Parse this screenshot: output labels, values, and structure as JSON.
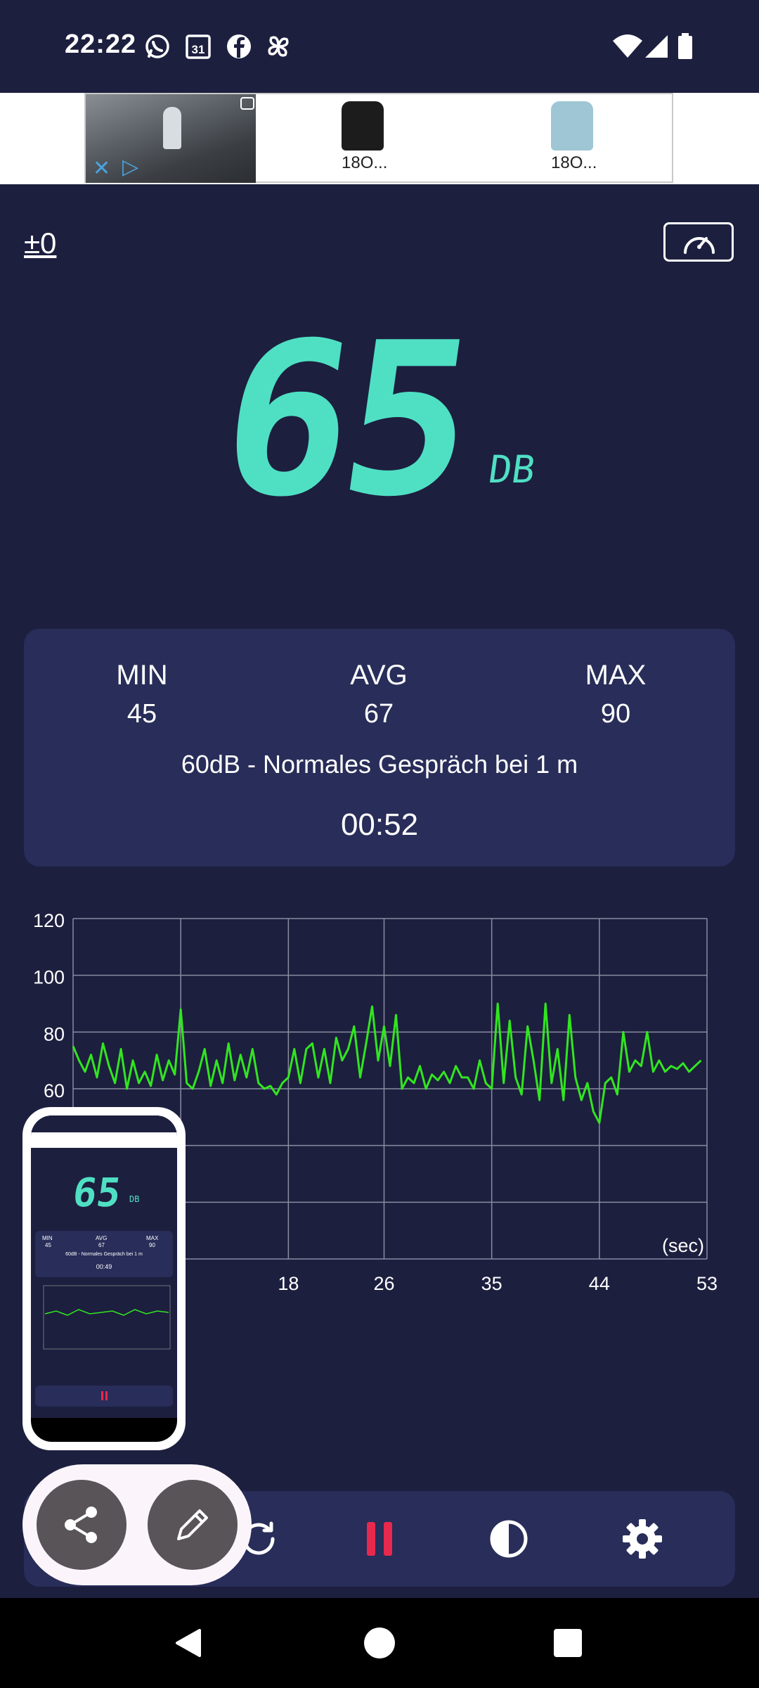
{
  "status_bar": {
    "time": "22:22",
    "notification_icons": [
      "whatsapp-icon",
      "calendar-icon",
      "facebook-icon",
      "pinwheel-icon"
    ],
    "calendar_day": "31",
    "right_icons": [
      "wifi-icon",
      "signal-icon",
      "battery-icon"
    ]
  },
  "ad": {
    "products": [
      {
        "price": "18O...",
        "color": "#1c1c1c"
      },
      {
        "price": "18O...",
        "color": "#9fc6d4"
      }
    ],
    "close_symbol": "✕",
    "play_symbol": "▷"
  },
  "controls": {
    "calibration": "±0",
    "mode_icon": "speedometer-icon"
  },
  "display": {
    "value": "65",
    "unit": "DB",
    "color": "#4fe0c4"
  },
  "stats": {
    "min_label": "MIN",
    "min_value": "45",
    "avg_label": "AVG",
    "avg_value": "67",
    "max_label": "MAX",
    "max_value": "90",
    "description": "60dB - Normales Gespräch bei 1 m",
    "timer": "00:52"
  },
  "chart_data": {
    "type": "line",
    "ylim": [
      0,
      120
    ],
    "xlim": [
      0,
      53
    ],
    "y_ticks": [
      "120",
      "100",
      "80",
      "60"
    ],
    "x_ticks": [
      "18",
      "26",
      "35",
      "44",
      "53"
    ],
    "x_unit": "(sec)",
    "grid": true,
    "line_color": "#31e61f",
    "series": [
      {
        "x": [
          0,
          0.5,
          1,
          1.5,
          2,
          2.5,
          3,
          3.5,
          4,
          4.5,
          5,
          5.5,
          6,
          6.5,
          7,
          7.5,
          8,
          8.5,
          9,
          9.5,
          10,
          10.5,
          11,
          11.5,
          12,
          12.5,
          13,
          13.5,
          14,
          14.5,
          15,
          15.5,
          16,
          16.5,
          17,
          17.5,
          18,
          18.5,
          19,
          19.5,
          20,
          20.5,
          21,
          21.5,
          22,
          22.5,
          23,
          23.5,
          24,
          24.5,
          25,
          25.5,
          26,
          26.5,
          27,
          27.5,
          28,
          28.5,
          29,
          29.5,
          30,
          30.5,
          31,
          31.5,
          32,
          32.5,
          33,
          33.5,
          34,
          34.5,
          35,
          35.5,
          36,
          36.5,
          37,
          37.5,
          38,
          38.5,
          39,
          39.5,
          40,
          40.5,
          41,
          41.5,
          42,
          42.5,
          43,
          43.5,
          44,
          44.5,
          45,
          45.5,
          46,
          46.5,
          47,
          47.5,
          48,
          48.5,
          49,
          49.5,
          50,
          50.5,
          51,
          51.5,
          52,
          52.5
        ],
        "values": [
          75,
          70,
          66,
          72,
          64,
          76,
          68,
          62,
          74,
          60,
          70,
          62,
          66,
          61,
          72,
          63,
          70,
          65,
          88,
          62,
          60,
          66,
          74,
          61,
          70,
          62,
          76,
          63,
          72,
          64,
          74,
          62,
          60,
          61,
          58,
          62,
          64,
          74,
          62,
          74,
          76,
          64,
          74,
          62,
          78,
          70,
          74,
          82,
          64,
          76,
          89,
          70,
          82,
          68,
          86,
          60,
          64,
          62,
          68,
          60,
          65,
          63,
          66,
          62,
          68,
          64,
          64,
          60,
          70,
          62,
          60,
          90,
          62,
          84,
          64,
          58,
          82,
          70,
          56,
          90,
          62,
          74,
          56,
          86,
          64,
          56,
          62,
          52,
          48,
          62,
          64,
          58,
          80,
          66,
          70,
          68,
          80,
          66,
          70,
          66,
          68,
          67,
          69,
          66,
          68,
          70
        ]
      }
    ]
  },
  "mini_preview": {
    "value": "65",
    "unit": "DB",
    "min_label": "MIN",
    "min_value": "45",
    "avg_label": "AVG",
    "avg_value": "67",
    "max_label": "MAX",
    "max_value": "90",
    "description": "60dB - Normales Gespräch bei 1 m",
    "timer": "00:49"
  },
  "toolbar": {
    "icons": [
      "swap-icon",
      "reset-icon",
      "pause-icon",
      "contrast-icon",
      "settings-icon"
    ],
    "pause_color": "#e8294d"
  },
  "fab": {
    "icons": [
      "share-icon",
      "edit-icon"
    ]
  },
  "nav": {
    "icons": [
      "back-icon",
      "home-icon",
      "recents-icon"
    ]
  }
}
